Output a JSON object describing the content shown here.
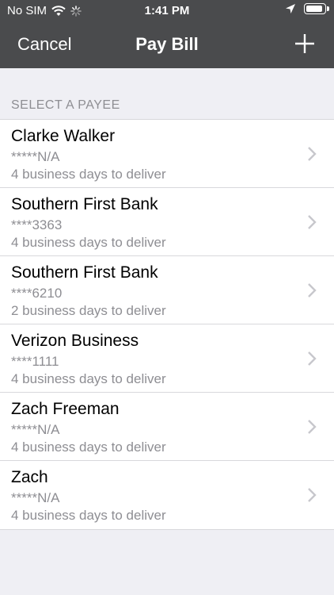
{
  "status_bar": {
    "carrier": "No SIM",
    "time": "1:41 PM"
  },
  "nav": {
    "cancel_label": "Cancel",
    "title": "Pay Bill",
    "add_icon": "plus-icon"
  },
  "section": {
    "header": "SELECT A PAYEE"
  },
  "payees": [
    {
      "name": "Clarke Walker",
      "account": "*****N/A",
      "delivery": "4 business days to deliver"
    },
    {
      "name": "Southern First Bank",
      "account": "****3363",
      "delivery": "4 business days to deliver"
    },
    {
      "name": "Southern First Bank",
      "account": "****6210",
      "delivery": "2 business days to deliver"
    },
    {
      "name": "Verizon Business",
      "account": "****1111",
      "delivery": "4 business days to deliver"
    },
    {
      "name": "Zach Freeman",
      "account": "*****N/A",
      "delivery": "4 business days to deliver"
    },
    {
      "name": "Zach",
      "account": "*****N/A",
      "delivery": "4 business days to deliver"
    }
  ],
  "colors": {
    "nav_bg": "#4a4b4d",
    "page_bg": "#efeff4",
    "secondary_text": "#8e8e93"
  }
}
